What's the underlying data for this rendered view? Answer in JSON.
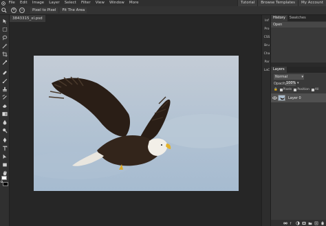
{
  "menubar": {
    "items": [
      "File",
      "Edit",
      "Image",
      "Layer",
      "Select",
      "Filter",
      "View",
      "Window",
      "More"
    ],
    "right": [
      "Tutorial",
      "Browse Templates",
      "My Account"
    ]
  },
  "options": {
    "plus": "+",
    "minus": "−",
    "pixel_to_pixel": "Pixel to Pixel",
    "fit_area": "Fit The Area"
  },
  "document": {
    "tab_label": "3843315_xl.psd"
  },
  "mini_panels": [
    "Inf",
    "Pro",
    "CSS",
    "Bru",
    "Cha",
    "Par",
    "LaC"
  ],
  "history": {
    "tabs": [
      "History",
      "Swatches"
    ],
    "entries": [
      "Open"
    ]
  },
  "layers": {
    "title": "Layers",
    "blend_mode": "Normal",
    "opacity_label": "Opacity:",
    "opacity_value": "100%",
    "lock_label": "🔒",
    "lock_options": [
      "Pixels",
      "Position",
      "All"
    ],
    "rows": [
      {
        "name": "Layer 0"
      }
    ]
  },
  "colors": {
    "accent": "#3a3a3a",
    "foreground": "#ffffff",
    "background": "#000000"
  }
}
